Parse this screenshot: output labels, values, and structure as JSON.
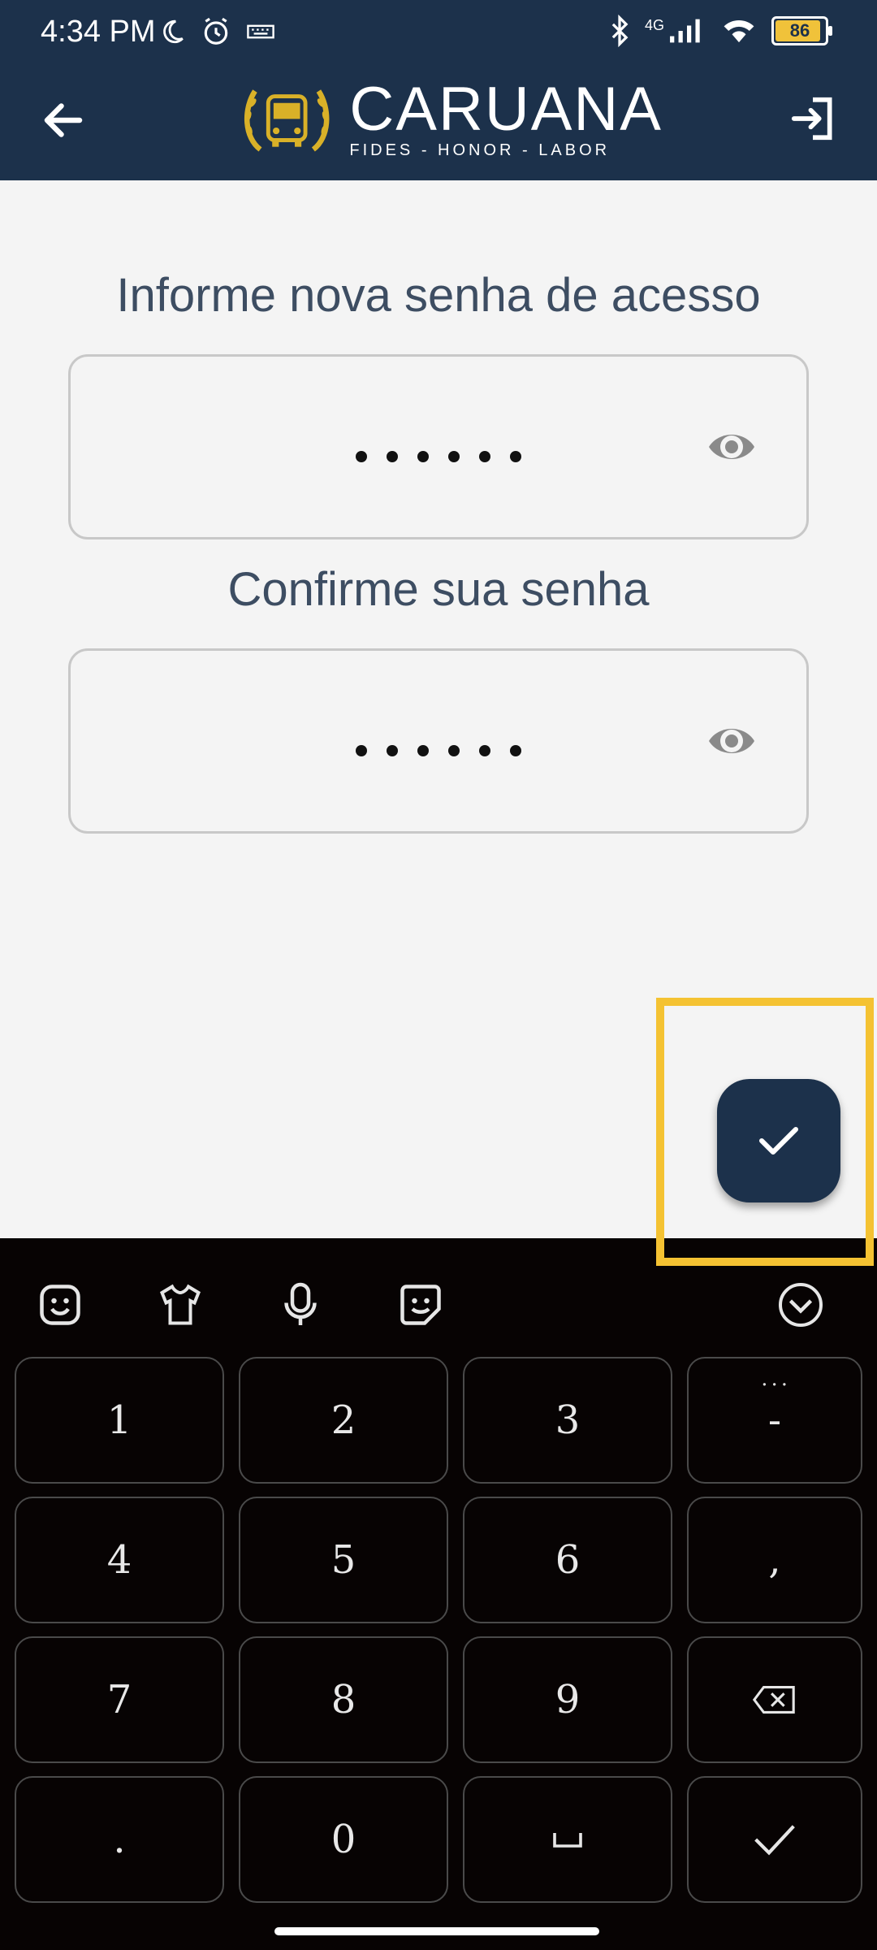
{
  "status_bar": {
    "time": "4:34 PM",
    "network": "4G",
    "battery": "86",
    "icons_left": [
      "moon-icon",
      "alarm-icon",
      "keyboard-icon"
    ],
    "icons_right": [
      "bluetooth-icon",
      "signal-icon",
      "wifi-icon",
      "battery-icon"
    ]
  },
  "header": {
    "logo_title": "CARUANA",
    "logo_subtitle": "FIDES - HONOR - LABOR",
    "back_icon": "arrow-left-icon",
    "exit_icon": "exit-icon"
  },
  "form": {
    "new_password_label": "Informe nova senha de acesso",
    "confirm_password_label": "Confirme sua senha",
    "password_mask": "••••••",
    "confirm_mask": "••••••"
  },
  "fab": {
    "icon": "check-icon"
  },
  "keyboard": {
    "toolbar": [
      "emoji-icon",
      "shirt-icon",
      "microphone-icon",
      "sticker-icon",
      "collapse-icon"
    ],
    "keys": [
      [
        "1",
        "2",
        "3",
        "-"
      ],
      [
        "4",
        "5",
        "6",
        ","
      ],
      [
        "7",
        "8",
        "9",
        "⌫"
      ],
      [
        ".",
        "0",
        "␣",
        "✓"
      ]
    ],
    "more_symbols": "..."
  },
  "colors": {
    "header": "#1c314b",
    "accent_gold": "#f4c232",
    "background": "#f4f4f4",
    "keyboard": "#070303"
  }
}
